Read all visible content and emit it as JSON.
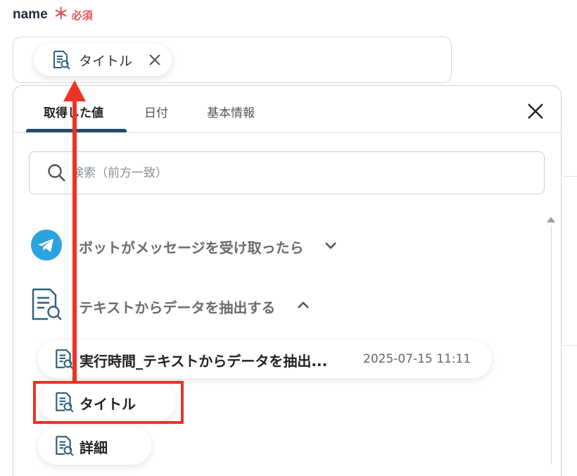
{
  "field": {
    "name_label": "name",
    "required_mark": "＊",
    "required_text": "必須",
    "chip_label": "タイトル"
  },
  "tabs": [
    {
      "label": "取得した値",
      "active": true
    },
    {
      "label": "日付",
      "active": false
    },
    {
      "label": "基本情報",
      "active": false
    }
  ],
  "search": {
    "placeholder": "検索（前方一致）",
    "value": ""
  },
  "sections": [
    {
      "title": "ボットがメッセージを受け取ったら",
      "expanded": false,
      "icon": "telegram-icon"
    },
    {
      "title": "テキストからデータを抽出する",
      "expanded": true,
      "icon": "document-search-icon"
    }
  ],
  "items": [
    {
      "label": "実行時間_テキストからデータを抽出...",
      "time": "2025-07-15 11:11"
    },
    {
      "label": "タイトル",
      "time": ""
    },
    {
      "label": "詳細",
      "time": ""
    }
  ],
  "colors": {
    "required": "#e2545a",
    "tab_underline": "#1f4e70",
    "annotation": "#ee3224",
    "telegram": "#2aa3df"
  }
}
